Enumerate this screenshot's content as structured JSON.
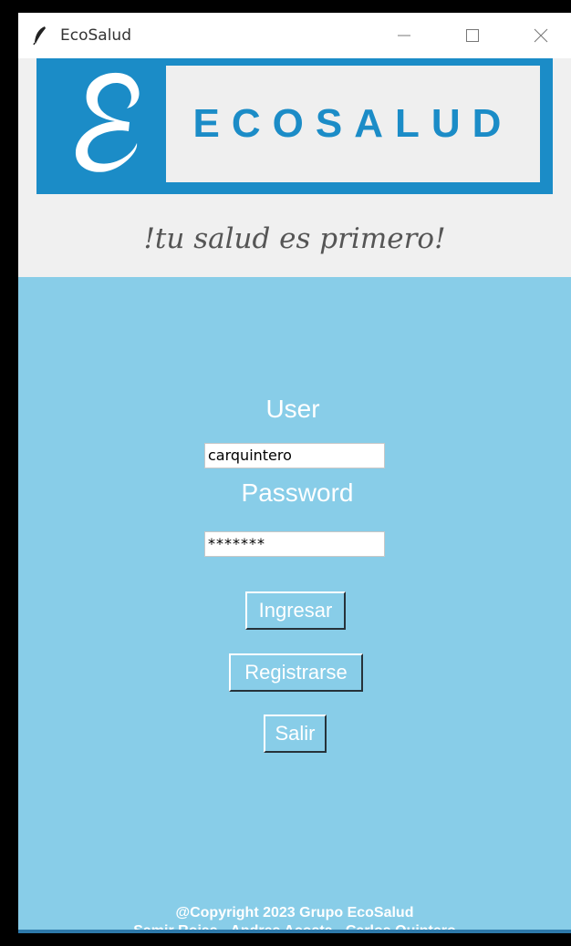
{
  "window": {
    "title": "EcoSalud",
    "controls": {
      "minimize": "minimize-icon",
      "maximize": "maximize-icon",
      "close": "close-icon"
    }
  },
  "header": {
    "brand": "ECOSALUD",
    "tagline": "!tu salud es primero!"
  },
  "form": {
    "user_label": "User",
    "user_value": "carquintero",
    "password_label": "Password",
    "password_value": "*******"
  },
  "buttons": {
    "ingresar": "Ingresar",
    "registrarse": "Registrarse",
    "salir": "Salir"
  },
  "footer": {
    "line1": "@Copyright 2023 Grupo EcoSalud",
    "line2": "Samir Rojas - Andres Acosta - Carlos Quintero"
  },
  "colors": {
    "window_bg": "#88cde8",
    "brand_blue": "#1b8cc7",
    "header_bg": "#f0f0f0"
  }
}
